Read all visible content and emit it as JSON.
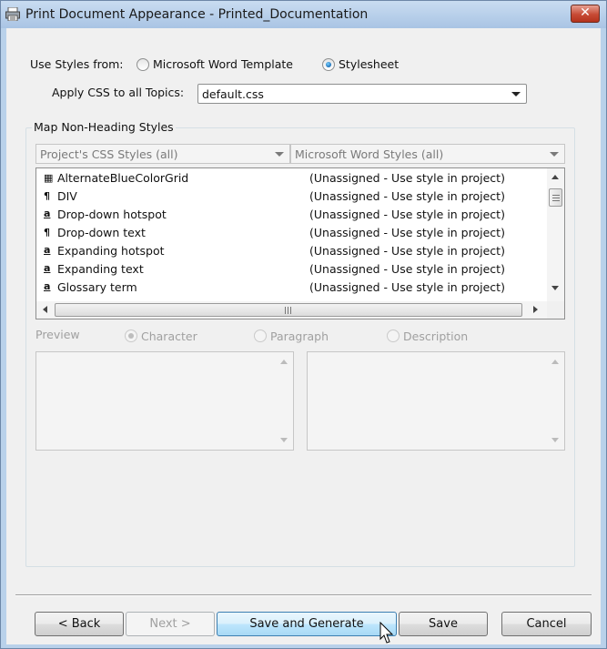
{
  "window": {
    "title": "Print Document Appearance - Printed_Documentation",
    "close_glyph": "✕"
  },
  "use_styles": {
    "label": "Use Styles from:",
    "options": [
      "Microsoft Word Template",
      "Stylesheet"
    ],
    "selected": "Stylesheet"
  },
  "apply_css": {
    "label": "Apply CSS to all Topics:",
    "value": "default.css"
  },
  "map_group": {
    "label": "Map Non-Heading Styles",
    "left_filter": "Project's CSS Styles (all)",
    "right_filter": "Microsoft Word Styles (all)",
    "rows": [
      {
        "icon": "table-style-icon",
        "glyph": "▦",
        "name": "AlternateBlueColorGrid",
        "status": "(Unassigned - Use style in project)"
      },
      {
        "icon": "paragraph-style-icon",
        "glyph": "¶",
        "name": "DIV",
        "status": "(Unassigned - Use style in project)"
      },
      {
        "icon": "character-style-icon",
        "glyph": "a",
        "name": "Drop-down hotspot",
        "status": "(Unassigned - Use style in project)"
      },
      {
        "icon": "paragraph-style-icon",
        "glyph": "¶",
        "name": "Drop-down text",
        "status": "(Unassigned - Use style in project)"
      },
      {
        "icon": "character-style-icon",
        "glyph": "a",
        "name": "Expanding hotspot",
        "status": "(Unassigned - Use style in project)"
      },
      {
        "icon": "character-style-icon",
        "glyph": "a",
        "name": "Expanding text",
        "status": "(Unassigned - Use style in project)"
      },
      {
        "icon": "character-style-icon",
        "glyph": "a",
        "name": "Glossary term",
        "status": "(Unassigned - Use style in project)"
      }
    ]
  },
  "preview": {
    "label": "Preview",
    "options": [
      "Character",
      "Paragraph",
      "Description"
    ],
    "selected": "Character"
  },
  "buttons": {
    "back": "< Back",
    "next": "Next >",
    "save_generate": "Save and Generate",
    "save": "Save",
    "cancel": "Cancel"
  }
}
